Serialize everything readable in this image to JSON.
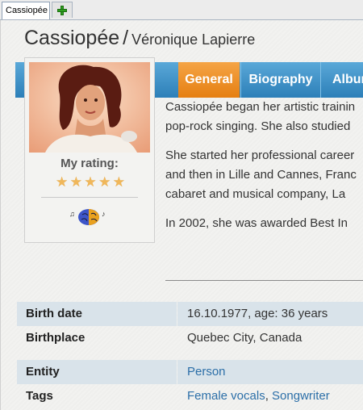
{
  "tab": {
    "label": "Cassiopée"
  },
  "header": {
    "name": "Cassiopée",
    "separator": "/",
    "real_name": "Véronique Lapierre"
  },
  "nav": {
    "tabs": [
      "General",
      "Biography",
      "Album"
    ],
    "active": "General"
  },
  "card": {
    "rating_label": "My rating:",
    "stars": 5
  },
  "bio": {
    "paragraphs": [
      [
        "Cassiopée began her artistic trainin",
        "pop-rock singing. She also studied"
      ],
      [
        "She started her professional career",
        "and then in Lille and Cannes, Franc",
        "cabaret and musical company, La"
      ],
      [
        "In 2002, she was awarded Best In"
      ]
    ]
  },
  "facts": [
    {
      "label": "Birth date",
      "value": "16.10.1977, age: 36 years"
    },
    {
      "label": "Birthplace",
      "value": "Quebec City, Canada"
    },
    {
      "label": "Entity",
      "value": "Person"
    },
    {
      "label": "Tags",
      "values": [
        "Female vocals",
        "Songwriter"
      ],
      "separator": ", "
    }
  ],
  "colors": {
    "nav_blue": "#2c7fb8",
    "nav_active_orange": "#e57f12",
    "link_blue": "#2c6fa8",
    "row_shade": "#d9e3ea"
  }
}
